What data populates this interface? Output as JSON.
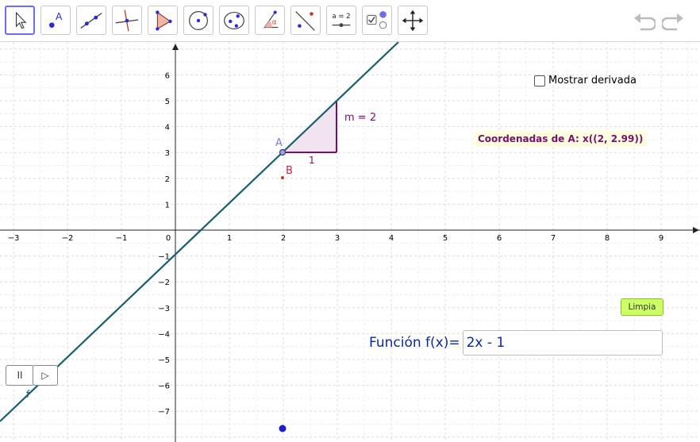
{
  "toolbar": {
    "tools": [
      {
        "id": "move",
        "icon": "cursor-arrow-icon",
        "active": true
      },
      {
        "id": "point",
        "icon": "point-icon",
        "label": "A"
      },
      {
        "id": "line",
        "icon": "line-icon"
      },
      {
        "id": "perpendicular",
        "icon": "perpendicular-line-icon"
      },
      {
        "id": "polygon",
        "icon": "polygon-icon"
      },
      {
        "id": "circle",
        "icon": "circle-center-point-icon"
      },
      {
        "id": "conic",
        "icon": "conic-icon"
      },
      {
        "id": "angle",
        "icon": "angle-icon",
        "label": "α"
      },
      {
        "id": "reflect",
        "icon": "reflect-icon"
      },
      {
        "id": "slider",
        "icon": "slider-icon",
        "label": "a = 2"
      },
      {
        "id": "checkbox",
        "icon": "checkbox-icon"
      },
      {
        "id": "move-graphics",
        "icon": "move-graphics-icon"
      }
    ],
    "undo_icon": "undo-icon",
    "redo_icon": "redo-icon"
  },
  "graph": {
    "x_ticks": [
      "−3",
      "−2",
      "−1",
      "0",
      "1",
      "2",
      "3",
      "4",
      "5",
      "6",
      "7",
      "8",
      "9"
    ],
    "y_ticks_pos": [
      "6",
      "5",
      "4",
      "3",
      "2",
      "1"
    ],
    "y_ticks_neg": [
      "−1",
      "−2",
      "−3",
      "−4",
      "−5",
      "−6",
      "−7"
    ],
    "line_color": "#1a5e6e",
    "function_name": "f",
    "point_A": {
      "label": "A",
      "x": 2,
      "y": 3
    },
    "point_B": {
      "label": "B",
      "x": 2,
      "y": 2
    },
    "slope_label": "m = 2",
    "run_label": "1",
    "slope_color": "#7a0e6e",
    "triangle_fill": "#f2e3f0"
  },
  "show_derivative_label": "Mostrar derivada",
  "coordinates_text": "Coordenadas de A: x((2, 2.99))",
  "clear_button_label": "Limpia",
  "function_label": "Función f(x)=",
  "function_value": "2x - 1",
  "play_controls": {
    "pause_label": "II",
    "play_label": "▷"
  }
}
